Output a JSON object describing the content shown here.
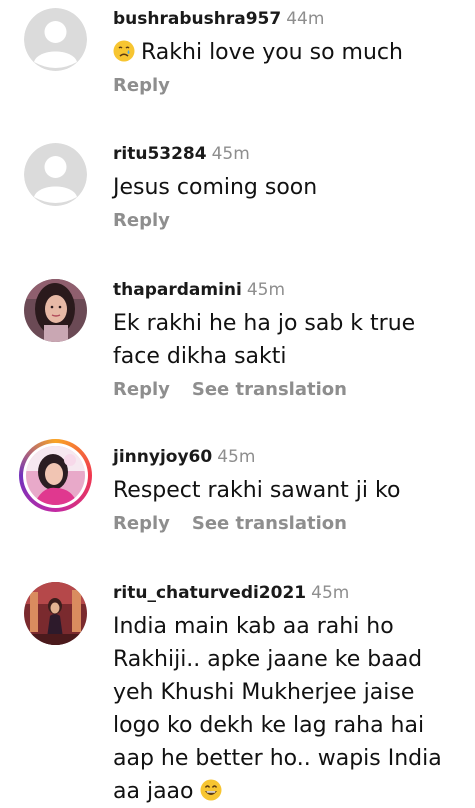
{
  "comments": [
    {
      "username": "bushrabushra957",
      "time": "44m",
      "emoji": "crying-face",
      "text": "Rakhi love you so much",
      "reply_label": "Reply"
    },
    {
      "username": "ritu53284",
      "time": "45m",
      "text": "Jesus coming soon",
      "reply_label": "Reply"
    },
    {
      "username": "thapardamini",
      "time": "45m",
      "text_lines": [
        "Ek rakhi he ha jo sab k true",
        "face dikha sakti"
      ],
      "reply_label": "Reply",
      "translate_label": "See translation"
    },
    {
      "username": "jinnyjoy60",
      "time": "45m",
      "text": "Respect rakhi sawant ji ko",
      "reply_label": "Reply",
      "translate_label": "See translation"
    },
    {
      "username": "ritu_chaturvedi2021",
      "time": "45m",
      "text_lines": [
        "India main kab aa rahi ho",
        "Rakhiji.. apke jaane ke baad",
        "yeh Khushi Mukherjee jaise",
        "logo ko dekh ke lag raha hai",
        "aap he better ho.. wapis India",
        "aa jaao"
      ],
      "emoji_end": "grinning-face"
    }
  ],
  "colors": {
    "muted": "#8e8e8e",
    "text": "#111111",
    "default_avatar_bg": "#dbdbdb"
  }
}
